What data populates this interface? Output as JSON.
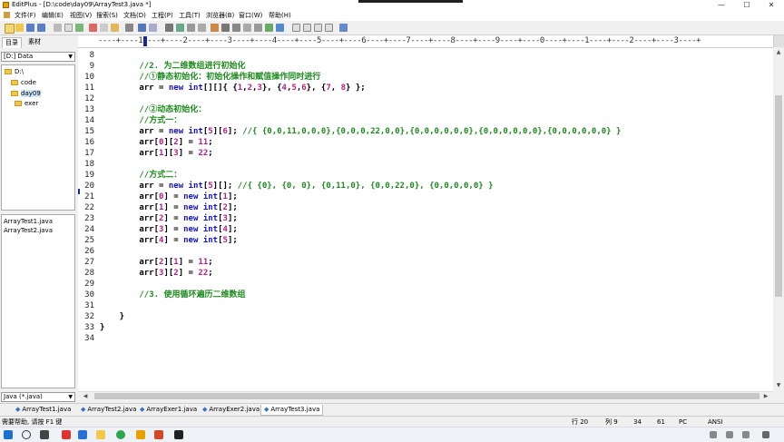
{
  "window": {
    "title": "EditPlus - [D:\\code\\day09\\ArrayTest3.java *]",
    "minimize": "—",
    "maximize": "☐",
    "close": "✕"
  },
  "menu": [
    "文件(F)",
    "编辑(E)",
    "视图(V)",
    "搜索(S)",
    "文档(D)",
    "工程(P)",
    "工具(T)",
    "浏览器(B)",
    "窗口(W)",
    "帮助(H)"
  ],
  "left_panel": {
    "tabs": [
      "目录",
      "素材"
    ],
    "drive": "[D:] Data",
    "tree": [
      {
        "label": "D:\\",
        "depth": 0
      },
      {
        "label": "code",
        "depth": 1
      },
      {
        "label": "day09",
        "depth": 1,
        "selected": true
      },
      {
        "label": "exer",
        "depth": 2
      }
    ],
    "files": [
      "ArrayTest1.java",
      "ArrayTest2.java"
    ],
    "filter": "Java (*.java)"
  },
  "ruler": "----+----1----+----2----+----3----+----4----+----5----+----6----+----7----+----8----+----9----+----0----+----1----+----2----+----3----+",
  "editor": {
    "lines": [
      {
        "n": "8",
        "code": ""
      },
      {
        "n": "9",
        "code": "        //2. 为二维数组进行初始化"
      },
      {
        "n": "10",
        "code": "        //①静态初始化：初始化操作和赋值操作同时进行"
      },
      {
        "n": "11",
        "code": "        arr = new int[][]{ {1,2,3}, {4,5,6}, {7, 8} };"
      },
      {
        "n": "12",
        "code": ""
      },
      {
        "n": "13",
        "code": "        //②动态初始化："
      },
      {
        "n": "14",
        "code": "        //方式一："
      },
      {
        "n": "15",
        "code": "        arr = new int[5][6]; //{ {0,0,11,0,0,0},{0,0,0,22,0,0},{0,0,0,0,0,0},{0,0,0,0,0,0},{0,0,0,0,0,0} }"
      },
      {
        "n": "16",
        "code": "        arr[0][2] = 11;"
      },
      {
        "n": "17",
        "code": "        arr[1][3] = 22;"
      },
      {
        "n": "18",
        "code": ""
      },
      {
        "n": "19",
        "code": "        //方式二："
      },
      {
        "n": "20",
        "code": "        arr = new int[5][]; //{ {0}, {0, 0}, {0,11,0}, {0,0,22,0}, {0,0,0,0,0} }"
      },
      {
        "n": "21",
        "code": "        arr[0] = new int[1];"
      },
      {
        "n": "22",
        "code": "        arr[1] = new int[2];"
      },
      {
        "n": "23",
        "code": "        arr[2] = new int[3];"
      },
      {
        "n": "24",
        "code": "        arr[3] = new int[4];"
      },
      {
        "n": "25",
        "code": "        arr[4] = new int[5];"
      },
      {
        "n": "26",
        "code": ""
      },
      {
        "n": "27",
        "code": "        arr[2][1] = 11;"
      },
      {
        "n": "28",
        "code": "        arr[3][2] = 22;"
      },
      {
        "n": "29",
        "code": ""
      },
      {
        "n": "30",
        "code": "        //3. 使用循环遍历二维数组"
      },
      {
        "n": "31",
        "code": ""
      },
      {
        "n": "32",
        "code": "    }"
      },
      {
        "n": "33",
        "code": "}"
      },
      {
        "n": "34",
        "code": ""
      }
    ]
  },
  "doc_tabs": [
    {
      "label": "ArrayTest1.java",
      "active": false
    },
    {
      "label": "ArrayTest2.java",
      "active": false
    },
    {
      "label": "ArrayExer1.java",
      "active": false
    },
    {
      "label": "ArrayExer2.java",
      "active": false
    },
    {
      "label": "ArrayTest3.java",
      "active": true
    }
  ],
  "status": {
    "help": "需要帮助, 请按 F1 键",
    "row": "行 20",
    "col": "列 9",
    "n1": "34",
    "n2": "61",
    "mode": "PC",
    "encoding": "ANSI"
  },
  "colors": {
    "keyword": "#1212cc",
    "number": "#b81c8a",
    "comment": "#1d8a1d"
  }
}
